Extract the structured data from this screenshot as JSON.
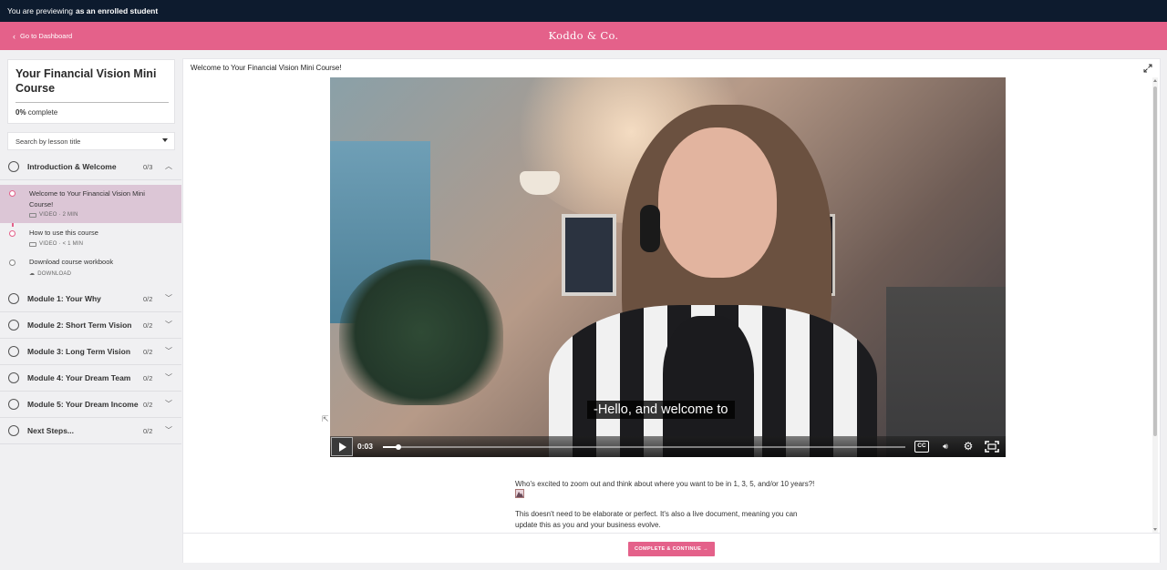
{
  "preview_bar": {
    "prefix": "You are previewing",
    "role": "as an enrolled student"
  },
  "header": {
    "back_label": "Go to Dashboard",
    "brand": "Koddo & Co.",
    "accent": "#e4618a"
  },
  "course": {
    "title": "Your Financial Vision Mini Course",
    "progress_percent": "0%",
    "progress_suffix": "complete"
  },
  "search": {
    "placeholder": "Search by lesson title"
  },
  "sections": [
    {
      "label": "Introduction & Welcome",
      "count": "0/3",
      "chevron": "chevron-up-icon"
    },
    {
      "label": "Module 1: Your Why",
      "count": "0/2",
      "chevron": "chevron-down-icon"
    },
    {
      "label": "Module 2: Short Term Vision",
      "count": "0/2",
      "chevron": "chevron-down-icon"
    },
    {
      "label": "Module 3: Long Term Vision",
      "count": "0/2",
      "chevron": "chevron-down-icon"
    },
    {
      "label": "Module 4: Your Dream Team",
      "count": "0/2",
      "chevron": "chevron-down-icon"
    },
    {
      "label": "Module 5: Your Dream Income",
      "count": "0/2",
      "chevron": "chevron-down-icon"
    },
    {
      "label": "Next Steps...",
      "count": "0/2",
      "chevron": "chevron-down-icon"
    }
  ],
  "lessons": [
    {
      "title_line1": "Welcome to Your Financial Vision Mini",
      "title_line2": "Course!",
      "meta": "VIDEO · 2 MIN",
      "active": true
    },
    {
      "title_line1": "How to use this course",
      "meta": "VIDEO · < 1 MIN",
      "active": false
    },
    {
      "title_line1": "Download course workbook",
      "meta": "DOWNLOAD",
      "active": false
    }
  ],
  "main": {
    "title": "Welcome to Your Financial Vision Mini Course!",
    "video": {
      "caption": "-Hello, and welcome to",
      "time": "0:03",
      "progress": 0.03
    },
    "desc_line1": "Who's excited to zoom out and think about where you want to be in 1, 3, 5, and/or 10 years?!",
    "desc_line2": "This doesn't need to be elaborate or perfect. It's also a live document, meaning you can",
    "desc_line3": "update this as you and your business evolve.",
    "complete_button": "COMPLETE & CONTINUE →"
  }
}
